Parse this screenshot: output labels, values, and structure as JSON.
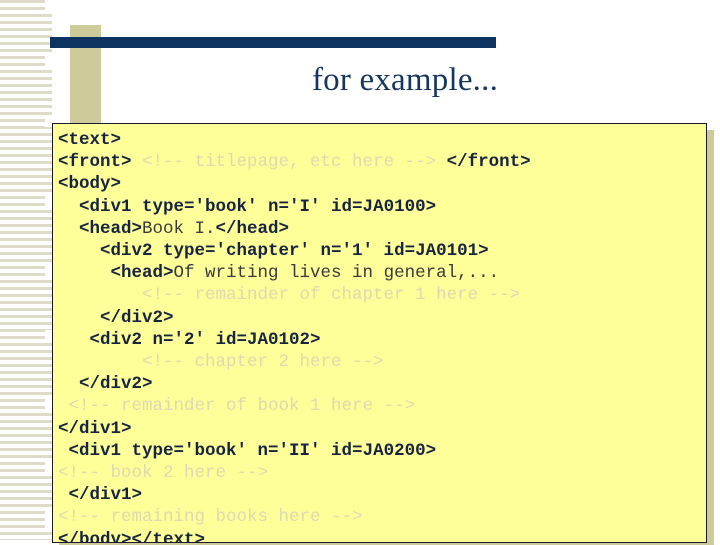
{
  "slide": {
    "title": "for example...",
    "colors": {
      "navy_rule": "#0d3460",
      "tan_bar": "#cdcb9a",
      "title_text": "#17365d",
      "code_background": "#ffff99",
      "code_border": "#1a1a2e",
      "code_shadow": "#cdcb9a",
      "tag_text": "#16243f",
      "comment_text": "#ddd9b0",
      "content_text": "#3a3a3a",
      "stripe": "#dedcc8"
    }
  },
  "code": {
    "lines": [
      {
        "indent": 0,
        "parts": [
          {
            "kind": "tag",
            "text": "<text>"
          }
        ]
      },
      {
        "indent": 0,
        "parts": [
          {
            "kind": "tag",
            "text": "<front>"
          },
          {
            "kind": "cmt",
            "text": " <!-- titlepage, etc here --> "
          },
          {
            "kind": "tag",
            "text": "</front>"
          }
        ]
      },
      {
        "indent": 0,
        "parts": [
          {
            "kind": "tag",
            "text": "<body>"
          }
        ]
      },
      {
        "indent": 2,
        "parts": [
          {
            "kind": "tag",
            "text": "<div1 type='book' n='I' id=JA0100>"
          }
        ]
      },
      {
        "indent": 2,
        "parts": [
          {
            "kind": "tag",
            "text": "<head>"
          },
          {
            "kind": "txt",
            "text": "Book I."
          },
          {
            "kind": "tag",
            "text": "</head>"
          }
        ]
      },
      {
        "indent": 4,
        "parts": [
          {
            "kind": "tag",
            "text": "<div2 type='chapter' n='1' id=JA0101>"
          }
        ]
      },
      {
        "indent": 5,
        "parts": [
          {
            "kind": "tag",
            "text": "<head>"
          },
          {
            "kind": "txt",
            "text": "Of writing lives in general,..."
          }
        ]
      },
      {
        "indent": 8,
        "parts": [
          {
            "kind": "cmt",
            "text": "<!-- remainder of chapter 1 here -->"
          }
        ]
      },
      {
        "indent": 4,
        "parts": [
          {
            "kind": "tag",
            "text": "</div2>"
          }
        ]
      },
      {
        "indent": 3,
        "parts": [
          {
            "kind": "tag",
            "text": "<div2 n='2' id=JA0102>"
          }
        ]
      },
      {
        "indent": 8,
        "parts": [
          {
            "kind": "cmt",
            "text": "<!-- chapter 2 here -->"
          }
        ]
      },
      {
        "indent": 2,
        "parts": [
          {
            "kind": "tag",
            "text": "</div2>"
          }
        ]
      },
      {
        "indent": 1,
        "parts": [
          {
            "kind": "cmt",
            "text": "<!-- remainder of book 1 here -->"
          }
        ]
      },
      {
        "indent": 0,
        "parts": [
          {
            "kind": "tag",
            "text": "</div1>"
          }
        ]
      },
      {
        "indent": 1,
        "parts": [
          {
            "kind": "tag",
            "text": "<div1 type='book' n='II' id=JA0200>"
          }
        ]
      },
      {
        "indent": 0,
        "parts": [
          {
            "kind": "cmt",
            "text": "<!-- book 2 here -->"
          }
        ]
      },
      {
        "indent": 1,
        "parts": [
          {
            "kind": "tag",
            "text": "</div1>"
          }
        ]
      },
      {
        "indent": 0,
        "parts": [
          {
            "kind": "cmt",
            "text": "<!-- remaining books here -->"
          }
        ]
      },
      {
        "indent": 0,
        "parts": [
          {
            "kind": "tag",
            "text": "</body></text>"
          }
        ]
      }
    ]
  }
}
